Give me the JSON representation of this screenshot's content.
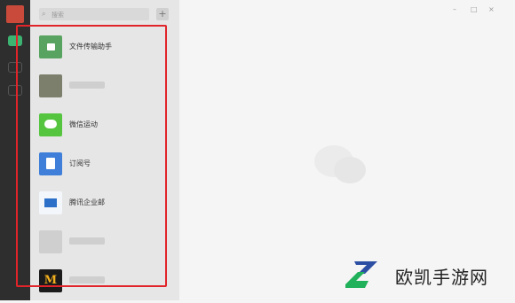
{
  "panel": {
    "search_placeholder": "搜索",
    "add_button": "+"
  },
  "chats": [
    {
      "label": "文件传输助手",
      "icon": "file-transfer-icon"
    },
    {
      "label": "",
      "icon": "blurred-avatar"
    },
    {
      "label": "微信运动",
      "icon": "wechat-sports-icon"
    },
    {
      "label": "订阅号",
      "icon": "subscription-icon"
    },
    {
      "label": "腾讯企业邮",
      "icon": "tencent-mail-icon"
    },
    {
      "label": "",
      "icon": "blurred-avatar"
    },
    {
      "label": "",
      "icon": "brand-avatar",
      "glyph": "M"
    }
  ],
  "window": {
    "minimize": "–",
    "maximize": "□",
    "close": "×"
  },
  "watermark": {
    "text": "欧凯手游网"
  },
  "colors": {
    "highlight": "#e0242a",
    "rail": "#2e2e2e",
    "accent_green": "#3cb371"
  }
}
